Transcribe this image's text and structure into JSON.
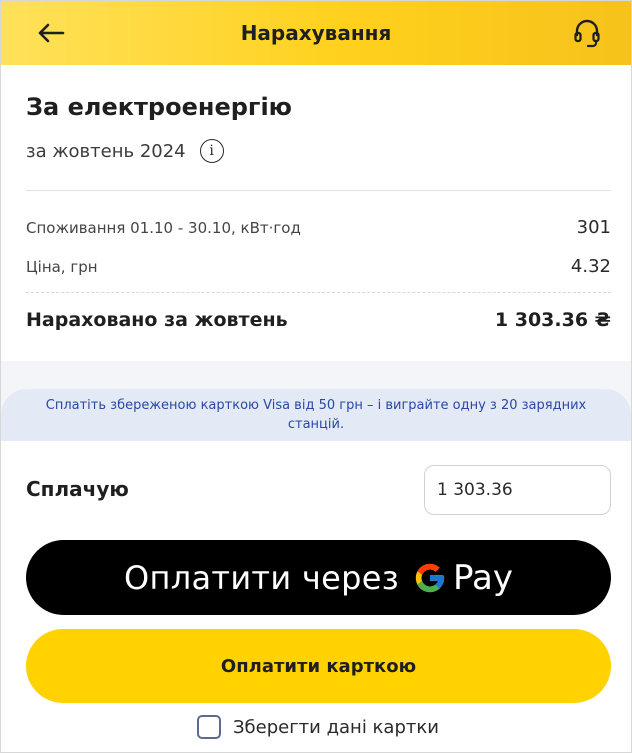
{
  "header": {
    "title": "Нарахування",
    "back_icon": "arrow-left-icon",
    "support_icon": "headset-icon"
  },
  "invoice": {
    "title": "За електроенергію",
    "period": "за жовтень 2024",
    "info_icon": "info-icon",
    "consumption_label": "Споживання 01.10 - 30.10, кВт·год",
    "consumption_value": "301",
    "price_label": "Ціна, грн",
    "price_value": "4.32",
    "total_label": "Нараховано за жовтень",
    "total_value": "1 303.36 ₴"
  },
  "promo": {
    "text": "Сплатіть збереженою карткою Visa від 50 грн – і виграйте одну з 20 зарядних станцій."
  },
  "payment": {
    "label": "Сплачую",
    "amount": "1 303.36",
    "gpay_label": "Оплатити через",
    "gpay_brand": "Pay",
    "card_button": "Оплатити карткою",
    "save_card_label": "Зберегти дані картки",
    "save_card_checked": false
  },
  "colors": {
    "header_yellow": "#ffd11d",
    "button_yellow": "#ffd200",
    "promo_text": "#2848a8",
    "gpay_black": "#000000"
  }
}
